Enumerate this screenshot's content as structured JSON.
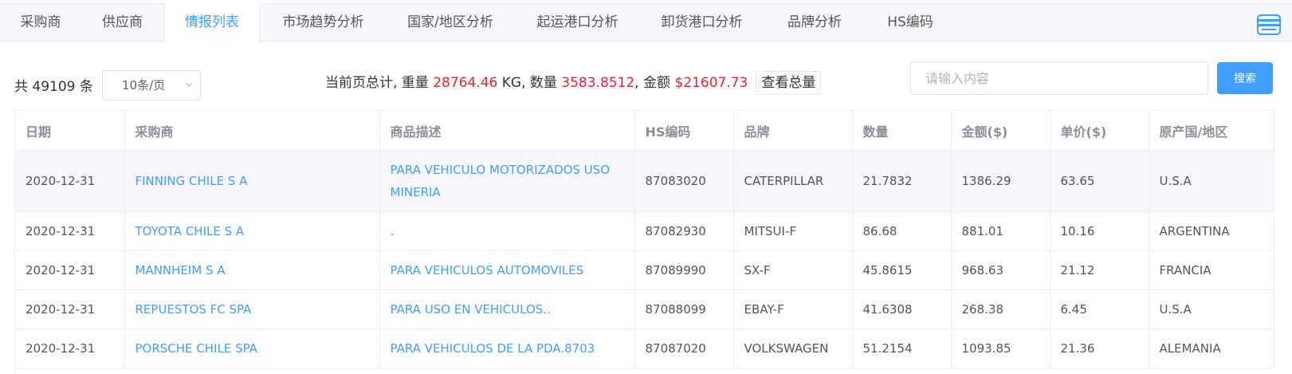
{
  "tabs": [
    {
      "label": "采购商",
      "active": false
    },
    {
      "label": "供应商",
      "active": false
    },
    {
      "label": "情报列表",
      "active": true
    },
    {
      "label": "市场趋势分析",
      "active": false
    },
    {
      "label": "国家/地区分析",
      "active": false
    },
    {
      "label": "起运港口分析",
      "active": false
    },
    {
      "label": "卸货港口分析",
      "active": false
    },
    {
      "label": "品牌分析",
      "active": false
    },
    {
      "label": "HS编码",
      "active": false
    }
  ],
  "toolbar": {
    "total_label": "共 49109 条",
    "page_size": "10条/页",
    "summary": {
      "prefix": "当前页总计, 重量 ",
      "weight": "28764.46",
      "weight_unit": " KG, 数量 ",
      "quantity": "3583.8512",
      "amount_label": ", 金额 ",
      "amount": "$21607.73",
      "view_total": "查看总量"
    },
    "search_placeholder": "请输入内容",
    "search_button": "搜索"
  },
  "table": {
    "headers": [
      "日期",
      "采购商",
      "商品描述",
      "HS编码",
      "品牌",
      "数量",
      "金额($)",
      "单价($)",
      "原产国/地区"
    ],
    "rows": [
      [
        "2020-12-31",
        "FINNING CHILE S A",
        "PARA VEHICULO MOTORIZADOS USO MINERIA",
        "87083020",
        "CATERPILLAR",
        "21.7832",
        "1386.29",
        "63.65",
        "U.S.A"
      ],
      [
        "2020-12-31",
        "TOYOTA CHILE S A",
        ".",
        "87082930",
        "MITSUI-F",
        "86.68",
        "881.01",
        "10.16",
        "ARGENTINA"
      ],
      [
        "2020-12-31",
        "MANNHEIM S A",
        "PARA VEHICULOS AUTOMOVILES",
        "87089990",
        "SX-F",
        "45.8615",
        "968.63",
        "21.12",
        "FRANCIA"
      ],
      [
        "2020-12-31",
        "REPUESTOS FC SPA",
        "PARA USO EN VEHICULOS..",
        "87088099",
        "EBAY-F",
        "41.6308",
        "268.38",
        "6.45",
        "U.S.A"
      ],
      [
        "2020-12-31",
        "PORSCHE CHILE SPA",
        "PARA VEHICULOS DE LA PDA.8703",
        "87087020",
        "VOLKSWAGEN",
        "51.2154",
        "1093.85",
        "21.36",
        "ALEMANIA"
      ]
    ]
  },
  "icons": {
    "export": "export-icon",
    "dropdown": "chevron-down-icon"
  },
  "colors": {
    "accent": "#409eff",
    "highlight": "#f5222d"
  }
}
